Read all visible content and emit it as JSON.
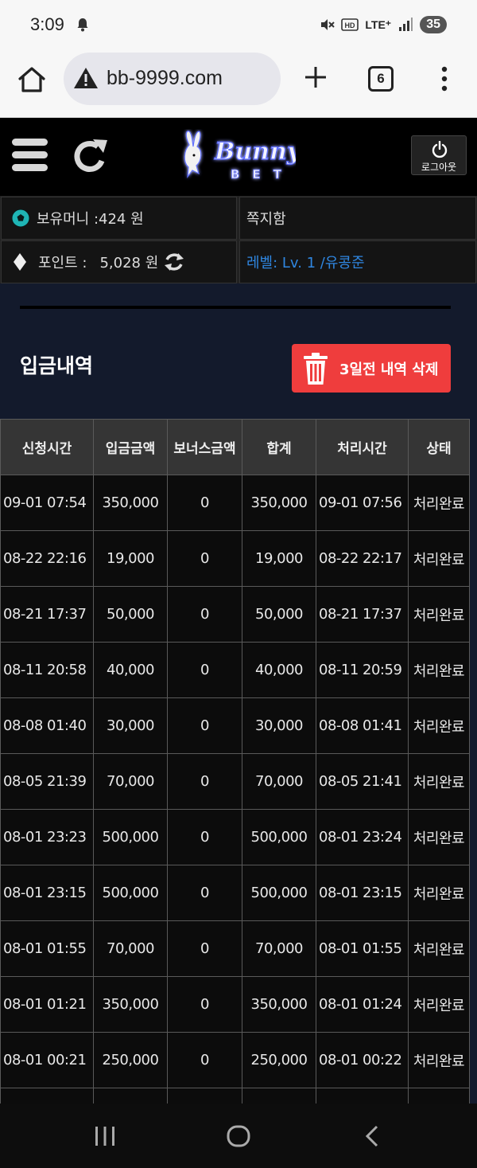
{
  "status_bar": {
    "time": "3:09",
    "network": "LTE⁺",
    "battery": "35"
  },
  "browser": {
    "url": "bb-9999.com",
    "tab_count": "6"
  },
  "site_header": {
    "logo_text_1": "Bunny",
    "logo_text_2": "BET",
    "logout_label": "로그아웃"
  },
  "user_info": {
    "money_label": "보유머니 :424 원",
    "message_label": "쪽지함",
    "points_label": "포인트 :",
    "points_value": "5,028 원",
    "level_label": "레벨: Lv. 1 /유콩준"
  },
  "deposit": {
    "title": "입금내역",
    "delete_button": "3일전 내역 삭제",
    "columns": [
      "신청시간",
      "입금금액",
      "보너스금액",
      "합계",
      "처리시간",
      "상태"
    ],
    "rows": [
      [
        "09-01 07:54",
        "350,000",
        "0",
        "350,000",
        "09-01 07:56",
        "처리완료"
      ],
      [
        "08-22 22:16",
        "19,000",
        "0",
        "19,000",
        "08-22 22:17",
        "처리완료"
      ],
      [
        "08-21 17:37",
        "50,000",
        "0",
        "50,000",
        "08-21 17:37",
        "처리완료"
      ],
      [
        "08-11 20:58",
        "40,000",
        "0",
        "40,000",
        "08-11 20:59",
        "처리완료"
      ],
      [
        "08-08 01:40",
        "30,000",
        "0",
        "30,000",
        "08-08 01:41",
        "처리완료"
      ],
      [
        "08-05 21:39",
        "70,000",
        "0",
        "70,000",
        "08-05 21:41",
        "처리완료"
      ],
      [
        "08-01 23:23",
        "500,000",
        "0",
        "500,000",
        "08-01 23:24",
        "처리완료"
      ],
      [
        "08-01 23:15",
        "500,000",
        "0",
        "500,000",
        "08-01 23:15",
        "처리완료"
      ],
      [
        "08-01 01:55",
        "70,000",
        "0",
        "70,000",
        "08-01 01:55",
        "처리완료"
      ],
      [
        "08-01 01:21",
        "350,000",
        "0",
        "350,000",
        "08-01 01:24",
        "처리완료"
      ],
      [
        "08-01 00:21",
        "250,000",
        "0",
        "250,000",
        "08-01 00:22",
        "처리완료"
      ],
      [
        "",
        "",
        "",
        "",
        "",
        ""
      ]
    ]
  },
  "colors": {
    "accent_red": "#ef3d3d",
    "level_blue": "#2f86e0",
    "logo_neon": "#5a6bff"
  }
}
